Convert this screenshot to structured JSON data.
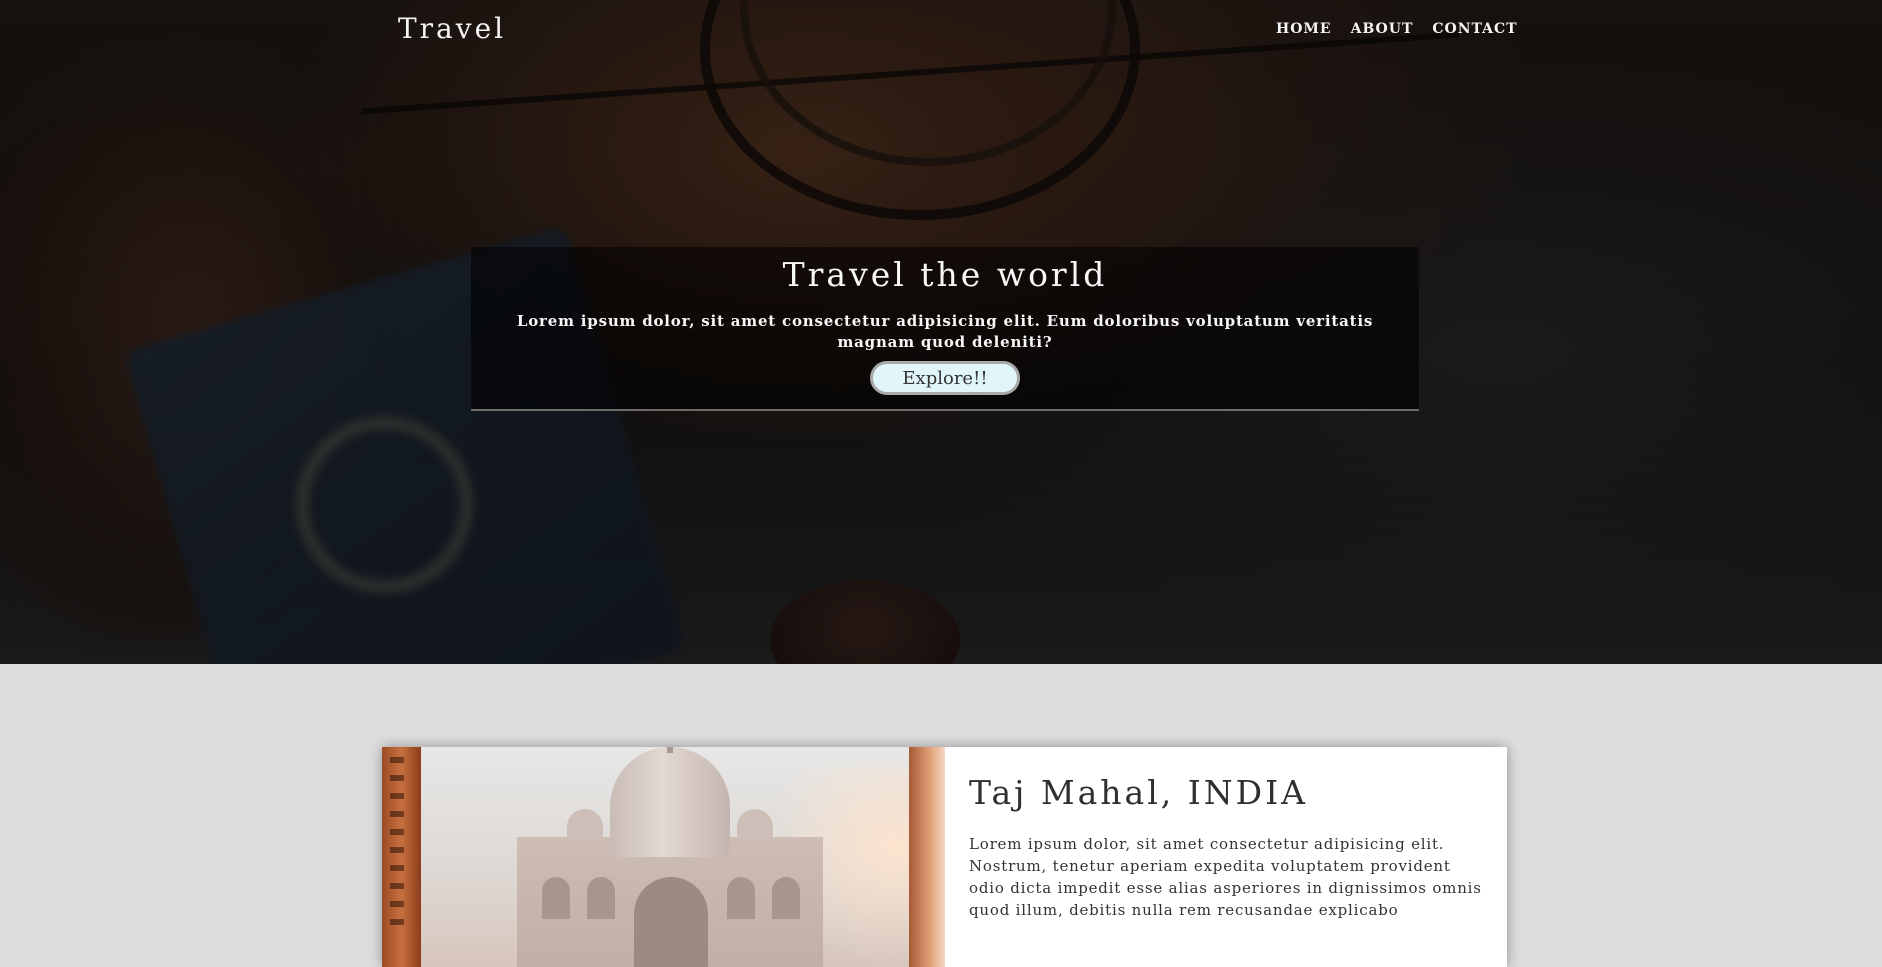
{
  "header": {
    "brand": "Travel",
    "nav": [
      {
        "label": "HOME"
      },
      {
        "label": "ABOUT"
      },
      {
        "label": "CONTACT"
      }
    ]
  },
  "hero": {
    "title": "Travel the world",
    "text": "Lorem ipsum dolor, sit amet consectetur adipisicing elit. Eum doloribus voluptatum veritatis magnam quod deleniti?",
    "button_label": "Explore!!"
  },
  "card": {
    "title": "Taj Mahal, INDIA",
    "text": "Lorem ipsum dolor, sit amet consectetur adipisicing elit. Nostrum, tenetur aperiam expedita voluptatem provident odio dicta impedit esse alias asperiores in dignissimos omnis quod illum, debitis nulla rem recusandae explicabo"
  },
  "colors": {
    "section_background": "#dddddd",
    "button_background": "#e0f6fb",
    "text_light": "#f4f4f4",
    "text_dark": "#333333"
  }
}
